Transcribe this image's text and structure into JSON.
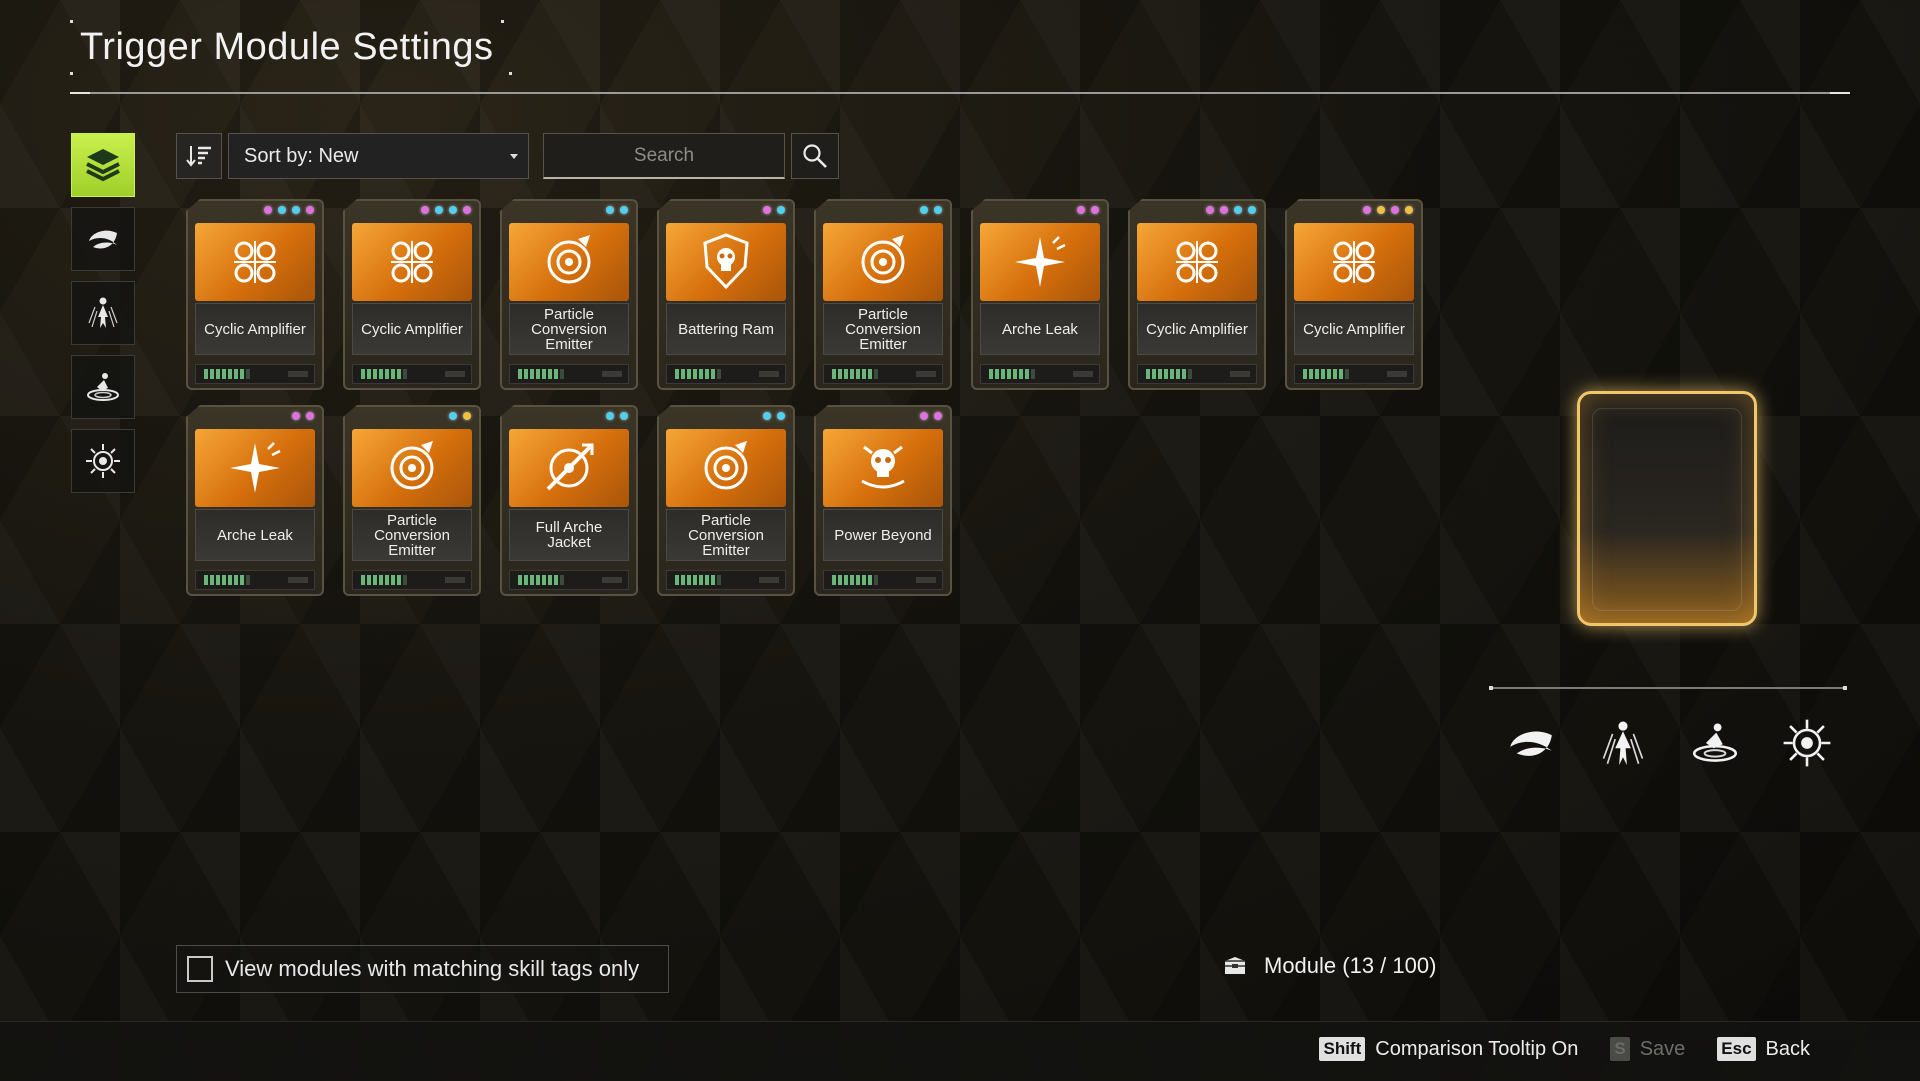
{
  "title": "Trigger Module Settings",
  "toolbar": {
    "sort_label": "Sort by: New",
    "search_placeholder": "Search"
  },
  "categories": [
    {
      "name": "all-modules",
      "active": true
    },
    {
      "name": "crescent",
      "active": false
    },
    {
      "name": "figure",
      "active": false
    },
    {
      "name": "swirl",
      "active": false
    },
    {
      "name": "burst",
      "active": false
    }
  ],
  "modules": [
    {
      "name": "Cyclic Amplifier",
      "dots": [
        "#e070e0",
        "#4fd0f0",
        "#4fd0f0",
        "#e070e0"
      ],
      "icon": "swirls-icon",
      "capacity": 7
    },
    {
      "name": "Cyclic Amplifier",
      "dots": [
        "#e070e0",
        "#4fd0f0",
        "#4fd0f0",
        "#e070e0"
      ],
      "icon": "swirls-icon",
      "capacity": 7
    },
    {
      "name": "Particle Conversion Emitter",
      "dots": [
        "#4fd0f0",
        "#4fd0f0"
      ],
      "icon": "target-icon",
      "capacity": 7
    },
    {
      "name": "Battering Ram",
      "dots": [
        "#e070e0",
        "#4fd0f0"
      ],
      "icon": "skull-shield-icon",
      "capacity": 7
    },
    {
      "name": "Particle Conversion Emitter",
      "dots": [
        "#4fd0f0",
        "#4fd0f0"
      ],
      "icon": "target-icon",
      "capacity": 7
    },
    {
      "name": "Arche Leak",
      "dots": [
        "#e070e0",
        "#e070e0"
      ],
      "icon": "sparkle-icon",
      "capacity": 7
    },
    {
      "name": "Cyclic Amplifier",
      "dots": [
        "#e070e0",
        "#e070e0",
        "#4fd0f0",
        "#4fd0f0"
      ],
      "icon": "swirls-icon",
      "capacity": 7
    },
    {
      "name": "Cyclic Amplifier",
      "dots": [
        "#e070e0",
        "#f0c040",
        "#e070e0",
        "#f0c040"
      ],
      "icon": "swirls-icon",
      "capacity": 7
    },
    {
      "name": "Arche Leak",
      "dots": [
        "#e070e0",
        "#e070e0"
      ],
      "icon": "sparkle-icon",
      "capacity": 7
    },
    {
      "name": "Particle Conversion Emitter",
      "dots": [
        "#4fd0f0",
        "#f0c040"
      ],
      "icon": "target-icon",
      "capacity": 7
    },
    {
      "name": "Full Arche Jacket",
      "dots": [
        "#4fd0f0",
        "#4fd0f0"
      ],
      "icon": "crosshair-icon",
      "capacity": 7
    },
    {
      "name": "Particle Conversion Emitter",
      "dots": [
        "#4fd0f0",
        "#4fd0f0"
      ],
      "icon": "target-icon",
      "capacity": 7
    },
    {
      "name": "Power Beyond",
      "dots": [
        "#e070e0",
        "#e070e0"
      ],
      "icon": "skull-icon",
      "capacity": 7
    }
  ],
  "skill_tags": [
    "crescent-icon",
    "figure-icon",
    "swirl-icon",
    "burst-icon"
  ],
  "filter_label": "View modules with matching skill tags only",
  "module_count": "Module (13 / 100)",
  "hints": {
    "comparison_key": "Shift",
    "comparison_label": "Comparison Tooltip On",
    "save_key": "S",
    "save_label": "Save",
    "back_key": "Esc",
    "back_label": "Back"
  },
  "colors": {
    "accent_green": "#c9f04d",
    "module_orange": "#e0841c",
    "preview_gold": "#f2c66a",
    "tag_pink": "#e070e0",
    "tag_cyan": "#4fd0f0",
    "tag_yellow": "#f0c040"
  }
}
